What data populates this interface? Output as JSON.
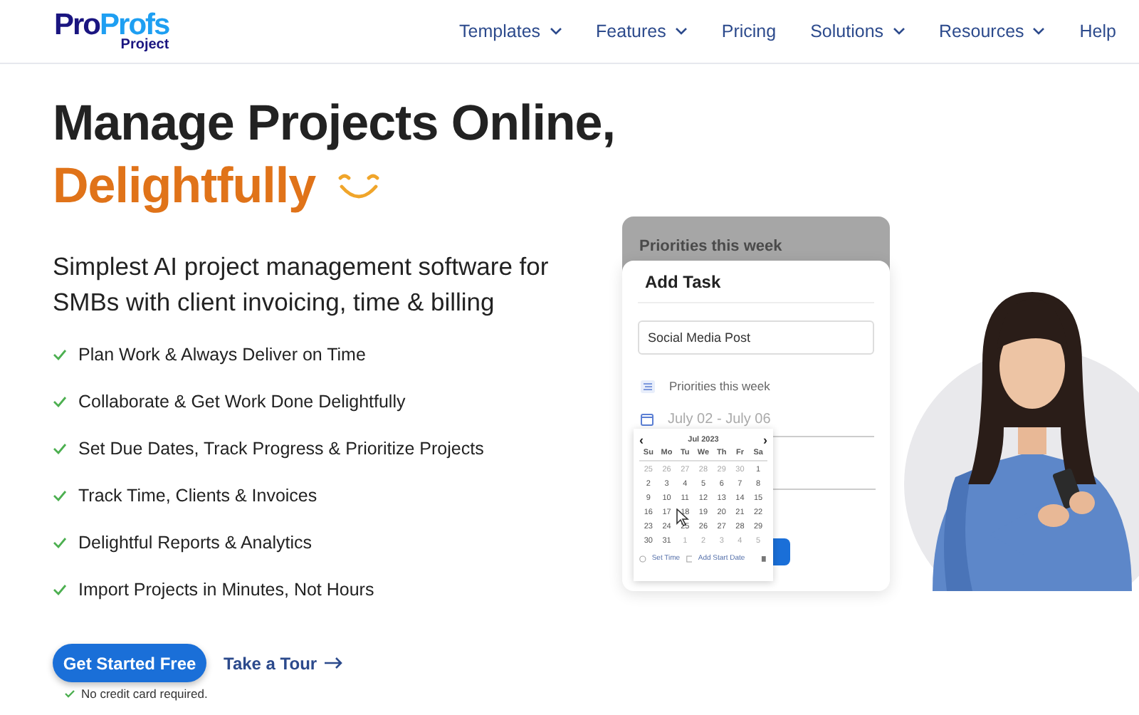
{
  "logo": {
    "brand_first": "Pro",
    "brand_second": "Profs",
    "product": "Project"
  },
  "nav": [
    {
      "label": "Templates",
      "dropdown": true
    },
    {
      "label": "Features",
      "dropdown": true
    },
    {
      "label": "Pricing",
      "dropdown": false
    },
    {
      "label": "Solutions",
      "dropdown": true
    },
    {
      "label": "Resources",
      "dropdown": true
    },
    {
      "label": "Help",
      "dropdown": false
    }
  ],
  "hero": {
    "title_line1": "Manage Projects Online,",
    "title_line2": "Delightfully",
    "subtitle": "Simplest AI project management software for SMBs with client invoicing, time & billing",
    "features": [
      "Plan Work & Always Deliver on Time",
      "Collaborate & Get Work Done Delightfully",
      "Set Due Dates, Track Progress & Prioritize Projects",
      "Track Time, Clients & Invoices",
      "Delightful Reports & Analytics",
      "Import Projects in Minutes, Not Hours"
    ],
    "cta": "Get Started Free",
    "tour": "Take a Tour",
    "note": "No credit card required."
  },
  "mockup": {
    "back_card_title": "Priorities this week",
    "title": "Add Task",
    "task_value": "Social Media Post",
    "list_label": "Priorities this week",
    "date_range": "July 02 - July 06",
    "calendar": {
      "prev": "‹",
      "next": "›",
      "month": "Jul 2023",
      "weekdays": [
        "Su",
        "Mo",
        "Tu",
        "We",
        "Th",
        "Fr",
        "Sa"
      ],
      "weeks": [
        [
          {
            "d": "25",
            "muted": true
          },
          {
            "d": "26",
            "muted": true
          },
          {
            "d": "27",
            "muted": true
          },
          {
            "d": "28",
            "muted": true
          },
          {
            "d": "29",
            "muted": true
          },
          {
            "d": "30",
            "muted": true
          },
          {
            "d": "1",
            "muted": false
          }
        ],
        [
          {
            "d": "2",
            "muted": false
          },
          {
            "d": "3",
            "muted": false
          },
          {
            "d": "4",
            "muted": false
          },
          {
            "d": "5",
            "muted": false
          },
          {
            "d": "6",
            "muted": false
          },
          {
            "d": "7",
            "muted": false
          },
          {
            "d": "8",
            "muted": false
          }
        ],
        [
          {
            "d": "9",
            "muted": false
          },
          {
            "d": "10",
            "muted": false
          },
          {
            "d": "11",
            "muted": false
          },
          {
            "d": "12",
            "muted": false
          },
          {
            "d": "13",
            "muted": false
          },
          {
            "d": "14",
            "muted": false
          },
          {
            "d": "15",
            "muted": false
          }
        ],
        [
          {
            "d": "16",
            "muted": false
          },
          {
            "d": "17",
            "muted": false
          },
          {
            "d": "18",
            "muted": false
          },
          {
            "d": "19",
            "muted": false
          },
          {
            "d": "20",
            "muted": false
          },
          {
            "d": "21",
            "muted": false
          },
          {
            "d": "22",
            "muted": false
          }
        ],
        [
          {
            "d": "23",
            "muted": false
          },
          {
            "d": "24",
            "muted": false
          },
          {
            "d": "25",
            "muted": false
          },
          {
            "d": "26",
            "muted": false
          },
          {
            "d": "27",
            "muted": false
          },
          {
            "d": "28",
            "muted": false
          },
          {
            "d": "29",
            "muted": false
          }
        ],
        [
          {
            "d": "30",
            "muted": false
          },
          {
            "d": "31",
            "muted": false
          },
          {
            "d": "1",
            "muted": true
          },
          {
            "d": "2",
            "muted": true
          },
          {
            "d": "3",
            "muted": true
          },
          {
            "d": "4",
            "muted": true
          },
          {
            "d": "5",
            "muted": true
          }
        ]
      ],
      "set_time": "Set Time",
      "add_start": "Add Start Date"
    }
  }
}
